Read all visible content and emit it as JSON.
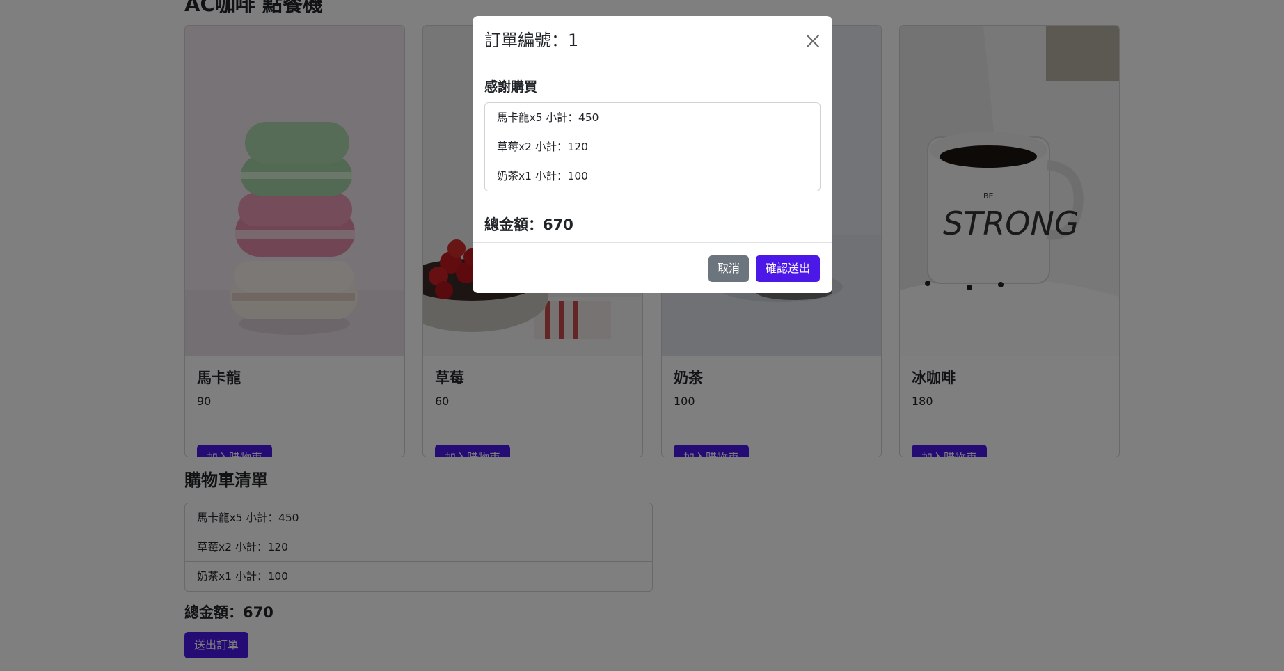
{
  "app": {
    "title": "AC咖啡 點餐機"
  },
  "products": [
    {
      "name": "馬卡龍",
      "price": "90",
      "button": "加入購物車",
      "image": "macaron-stack-image"
    },
    {
      "name": "草莓",
      "price": "60",
      "button": "加入購物車",
      "image": "strawberry-bowl-image"
    },
    {
      "name": "奶茶",
      "price": "100",
      "button": "加入購物車",
      "image": "milk-tea-image"
    },
    {
      "name": "冰咖啡",
      "price": "180",
      "button": "加入購物車",
      "image": "coffee-mug-image"
    }
  ],
  "cart": {
    "title": "購物車清單",
    "items": [
      "馬卡龍x5 小計：450",
      "草莓x2 小計：120",
      "奶茶x1 小計：100"
    ],
    "total": "總金額：670",
    "submit_label": "送出訂單"
  },
  "modal": {
    "title": "訂單編號：1",
    "subtitle": "感謝購買",
    "items": [
      "馬卡龍x5 小計：450",
      "草莓x2 小計：120",
      "奶茶x1 小計：100"
    ],
    "total": "總金額：670",
    "cancel_label": "取消",
    "confirm_label": "確認送出",
    "close_icon": "close-icon"
  },
  "colors": {
    "primary": "#4b18e8",
    "secondary": "#6c757d",
    "backdrop": "rgba(0,0,0,0.5)"
  }
}
